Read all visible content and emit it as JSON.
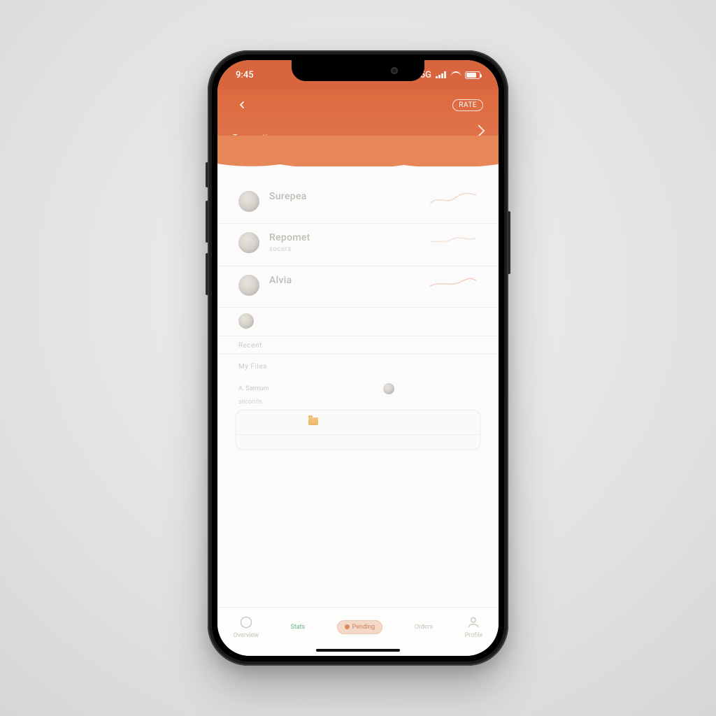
{
  "colors": {
    "accent": "#dd6a3f",
    "accent_light": "#e78657"
  },
  "statusbar": {
    "time": "9:45",
    "carrier": "5G"
  },
  "header": {
    "badge": "RATE",
    "subtitle": "Transactions"
  },
  "list": [
    {
      "title": "Surepea",
      "sub1": "",
      "sub2": ""
    },
    {
      "title": "Repomet",
      "sub1": "socers",
      "sub2": ""
    },
    {
      "title": "Alvia",
      "sub1": "",
      "sub2": ""
    },
    {
      "title": "",
      "sub1": "",
      "sub2": ""
    }
  ],
  "section_label_1": "Recent",
  "section_label_2": "My Files",
  "summary": {
    "head": [
      "A. Samium",
      "",
      "",
      ""
    ],
    "sub": "seconds",
    "rows": [
      [
        "",
        "",
        "",
        ""
      ],
      [
        "",
        "",
        "",
        ""
      ]
    ]
  },
  "tabs": {
    "items": [
      "Overview",
      "Stats",
      "Orders",
      "Profile"
    ],
    "chip": "Pending"
  }
}
